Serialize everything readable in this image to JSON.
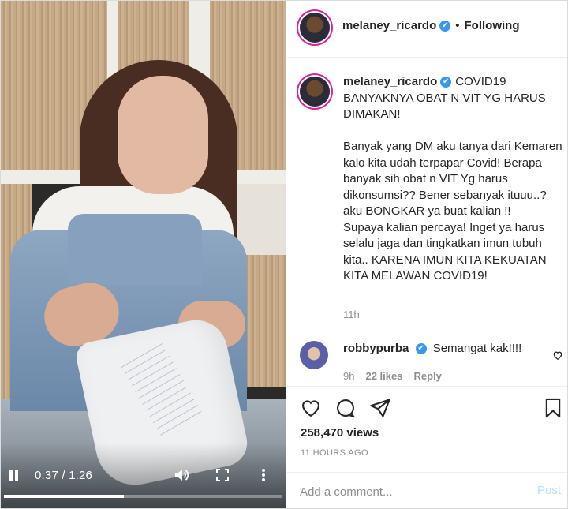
{
  "video": {
    "time_display": "0:37 / 1:26",
    "progress_fraction": 0.43
  },
  "header": {
    "username": "melaney_ricardo",
    "verified_mark": "✔",
    "separator": "•",
    "follow_status": "Following"
  },
  "caption": {
    "username": "melaney_ricardo",
    "text": "COVID19 BANYAKNYA OBAT N VIT YG HARUS DIMAKAN!\n\nBanyak yang DM aku tanya dari Kemaren kalo kita udah terpapar Covid! Berapa banyak sih obat n VIT Yg harus dikonsumsi?? Bener sebanyak ituuu..? aku BONGKAR ya buat kalian !! \nSupaya kalian percaya! Inget ya harus selalu jaga dan tingkatkan imun tubuh kita.. KARENA IMUN KITA KEKUATAN KITA MELAWAN COVID19!",
    "time": "11h"
  },
  "comment": {
    "username": "robbypurba",
    "text": "Semangat kak!!!!",
    "time": "9h",
    "likes": "22 likes",
    "reply_label": "Reply"
  },
  "stats": {
    "views": "258,470 views",
    "date": "11 HOURS AGO"
  },
  "add_comment": {
    "placeholder": "Add a comment...",
    "post_label": "Post"
  },
  "colors": {
    "verified": "#3897f0",
    "post_disabled": "#b2dffc",
    "muted": "#8e8e8e"
  },
  "icons": [
    "pause-icon",
    "volume-icon",
    "fullscreen-icon",
    "more-icon",
    "heart-icon",
    "comment-icon",
    "share-icon",
    "save-icon",
    "verified-badge-icon"
  ]
}
